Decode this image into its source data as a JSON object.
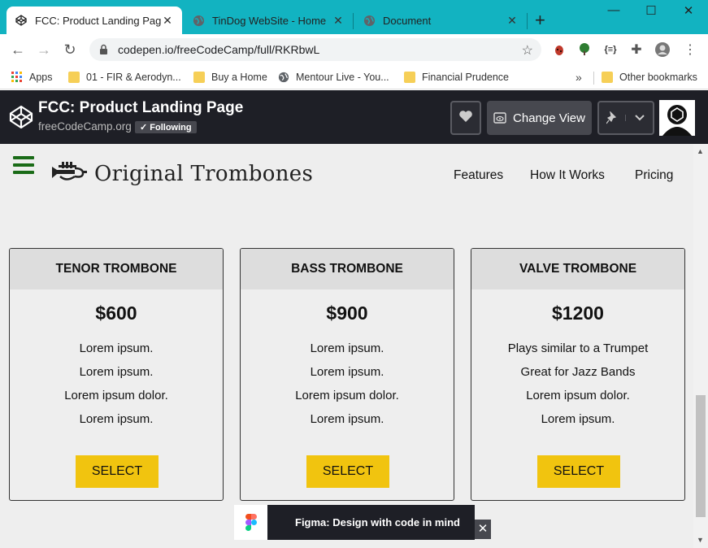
{
  "browser": {
    "tabs": [
      {
        "title": "FCC: Product Landing Page",
        "active": true
      },
      {
        "title": "TinDog WebSite - Home",
        "active": false
      },
      {
        "title": "Document",
        "active": false
      }
    ],
    "url": "codepen.io/freeCodeCamp/full/RKRbwL",
    "bookmarks": [
      {
        "label": "Apps"
      },
      {
        "label": "01 - FIR & Aerodyn..."
      },
      {
        "label": "Buy a Home"
      },
      {
        "label": "Mentour Live - You..."
      },
      {
        "label": "Financial Prudence"
      },
      {
        "label": "Other bookmarks"
      }
    ]
  },
  "codepen": {
    "title": "FCC: Product Landing Page",
    "author": "freeCodeCamp.org",
    "following_label": "✓ Following",
    "change_view_label": "Change View"
  },
  "page": {
    "brand": "Original Trombones",
    "nav": [
      "Features",
      "How It Works",
      "Pricing"
    ],
    "cards": [
      {
        "name": "TENOR TROMBONE",
        "price": "$600",
        "features": [
          "Lorem ipsum.",
          "Lorem ipsum.",
          "Lorem ipsum dolor.",
          "Lorem ipsum."
        ],
        "button": "SELECT"
      },
      {
        "name": "BASS TROMBONE",
        "price": "$900",
        "features": [
          "Lorem ipsum.",
          "Lorem ipsum.",
          "Lorem ipsum dolor.",
          "Lorem ipsum."
        ],
        "button": "SELECT"
      },
      {
        "name": "VALVE TROMBONE",
        "price": "$1200",
        "features": [
          "Plays similar to a Trumpet",
          "Great for Jazz Bands",
          "Lorem ipsum dolor.",
          "Lorem ipsum."
        ],
        "button": "SELECT"
      }
    ]
  },
  "ad": {
    "text": "Figma: Design with code in mind",
    "close": "✕"
  },
  "colors": {
    "tabstrip": "#12b3c1",
    "header": "#1e1f26",
    "button": "#f1c40f",
    "hamburger": "#1a6b17"
  }
}
